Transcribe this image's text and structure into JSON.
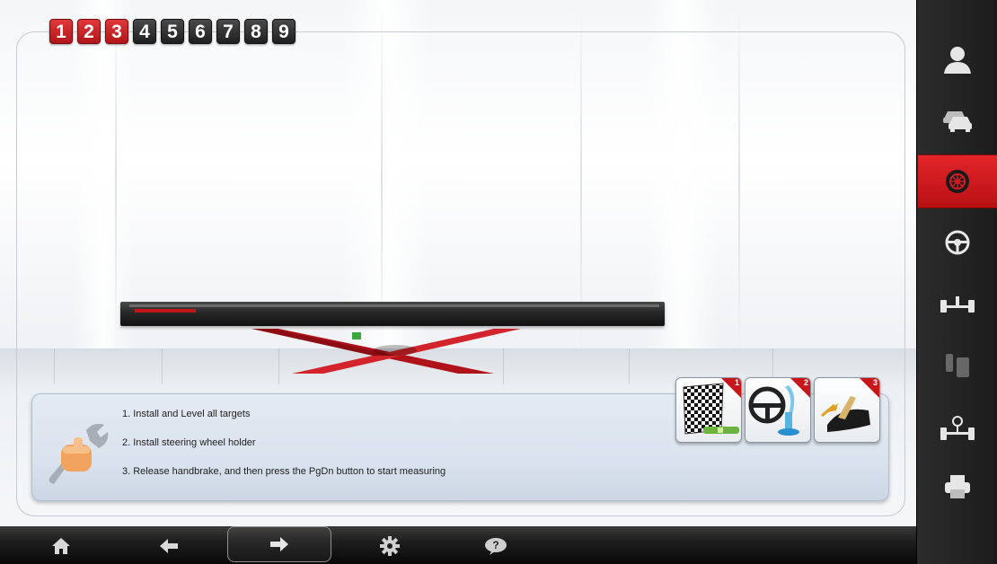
{
  "steps": [
    {
      "label": "1",
      "done": true
    },
    {
      "label": "2",
      "done": true
    },
    {
      "label": "3",
      "done": true
    },
    {
      "label": "4",
      "done": false
    },
    {
      "label": "5",
      "done": false
    },
    {
      "label": "6",
      "done": false
    },
    {
      "label": "7",
      "done": false
    },
    {
      "label": "8",
      "done": false
    },
    {
      "label": "9",
      "done": false
    }
  ],
  "instructions": {
    "line1": "1. Install and Level all targets",
    "line2": "2. Install steering wheel holder",
    "line3": "3. Release handbrake, and then press the PgDn button to start measuring"
  },
  "thumbnails": [
    {
      "badge": "1",
      "icon": "level-target-icon"
    },
    {
      "badge": "2",
      "icon": "steering-wheel-holder-icon"
    },
    {
      "badge": "3",
      "icon": "handbrake-icon"
    }
  ],
  "bottom_bar": {
    "buttons": [
      "home-icon",
      "back-arrow-icon",
      "next-arrow-icon",
      "settings-gear-icon",
      "help-icon"
    ]
  },
  "sidebar": {
    "items": [
      {
        "icon": "customer-icon",
        "active": false
      },
      {
        "icon": "vehicle-select-icon",
        "active": false
      },
      {
        "icon": "wheel-alignment-icon",
        "active": true
      },
      {
        "icon": "steering-wheel-icon",
        "active": false
      },
      {
        "icon": "axle-icon",
        "active": false
      },
      {
        "icon": "adjustment-icon",
        "active": false
      },
      {
        "icon": "axle-setup-icon",
        "active": false
      },
      {
        "icon": "printer-icon",
        "active": false
      }
    ]
  },
  "colors": {
    "accent_red": "#c8171b",
    "step_dark": "#2a2a2a",
    "sidebar_bg": "#222222"
  }
}
